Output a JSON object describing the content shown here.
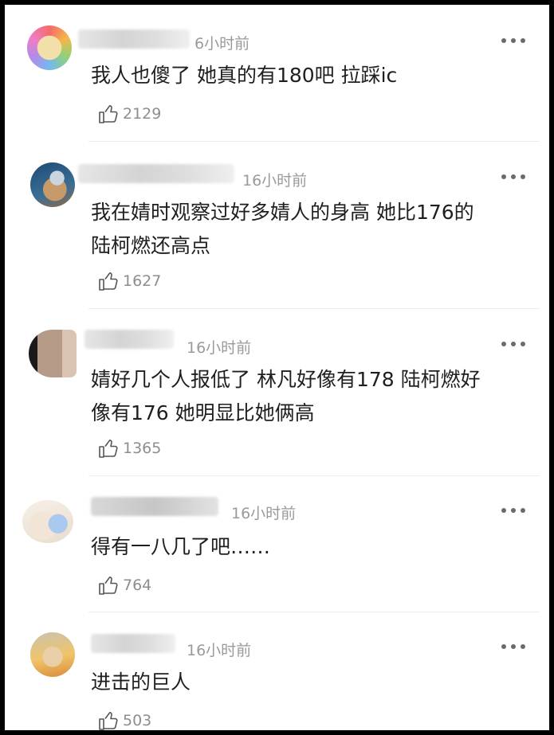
{
  "comments": [
    {
      "time": "6小时前",
      "text": "我人也傻了 她真的有180吧 拉踩ic",
      "likes": "2129"
    },
    {
      "time": "16小时前",
      "text": "我在婧时观察过好多婧人的身高 她比176的\n陆柯燃还高点",
      "likes": "1627"
    },
    {
      "time": "16小时前",
      "text": "婧好几个人报低了 林凡好像有178 陆柯燃好\n像有176 她明显比她俩高",
      "likes": "1365"
    },
    {
      "time": "16小时前",
      "text": "得有一八几了吧……",
      "likes": "764"
    },
    {
      "time": "16小时前",
      "text": "进击的巨人",
      "likes": "503"
    }
  ],
  "icons": {
    "like": "thumbs-up-icon",
    "more": "more-dots-icon"
  },
  "colors": {
    "time": "#9a9a9a",
    "text": "#1f1f1f",
    "count": "#8e8e8e",
    "frame": "#000000"
  }
}
